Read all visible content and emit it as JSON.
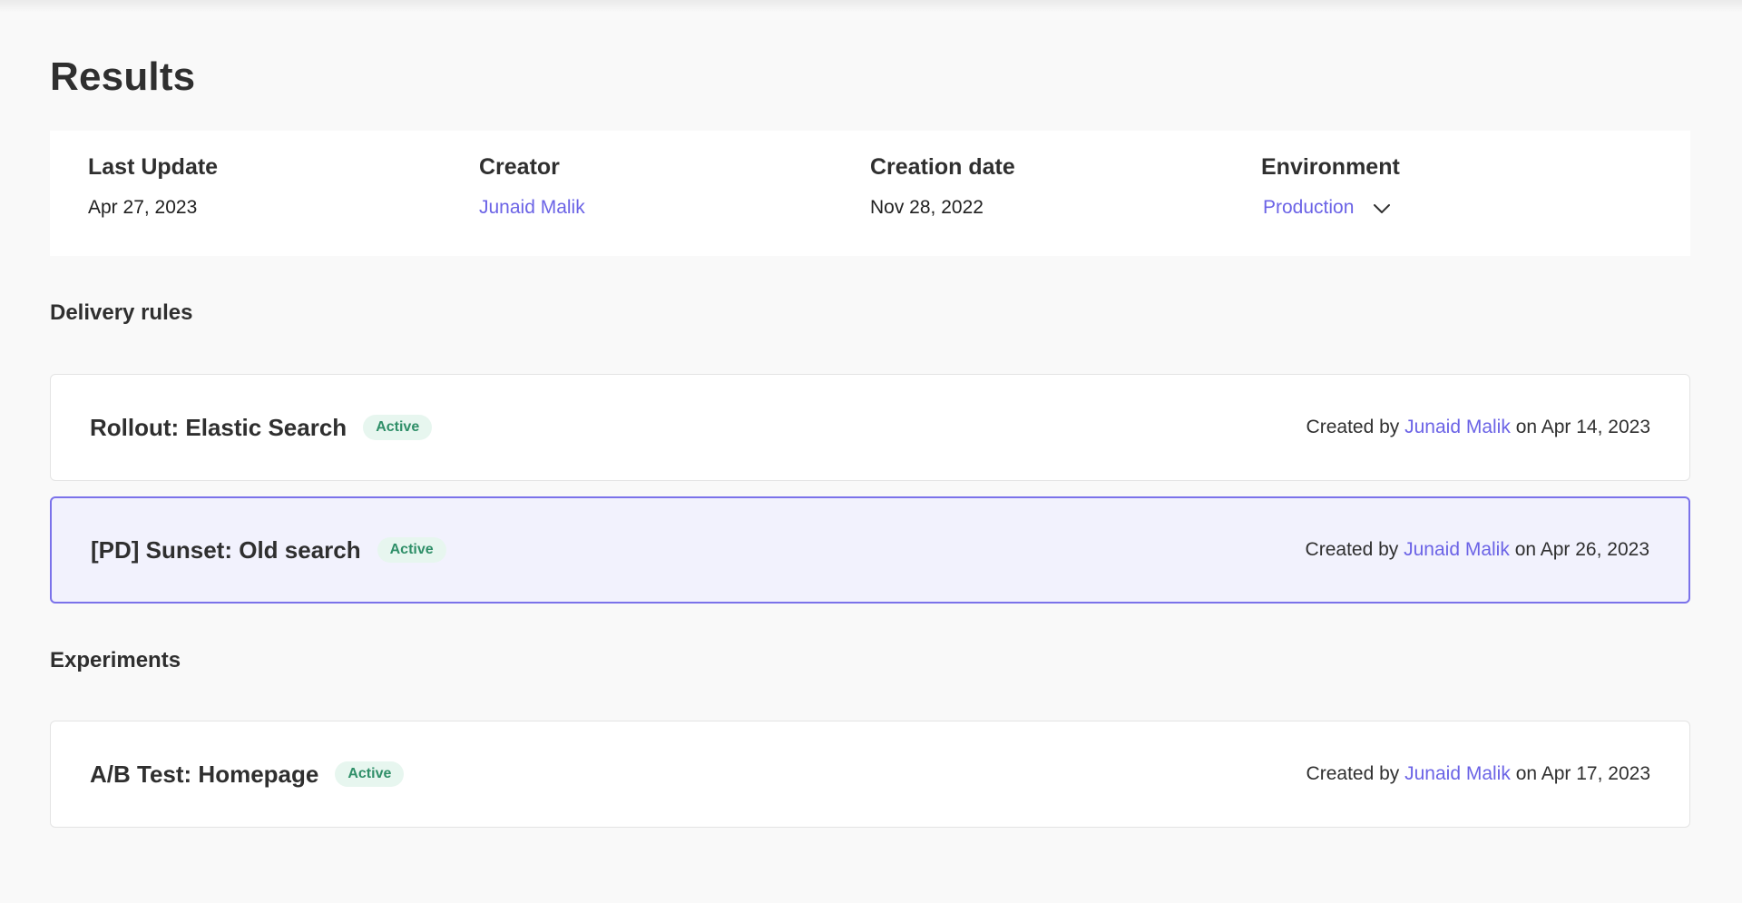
{
  "page": {
    "title": "Results"
  },
  "meta": {
    "last_update": {
      "label": "Last Update",
      "value": "Apr 27, 2023"
    },
    "creator": {
      "label": "Creator",
      "value": "Junaid Malik"
    },
    "creation_date": {
      "label": "Creation date",
      "value": "Nov 28, 2022"
    },
    "environment": {
      "label": "Environment",
      "value": "Production",
      "icon": "chevron-down-icon"
    }
  },
  "sections": {
    "delivery_rules": {
      "label": "Delivery rules",
      "items": [
        {
          "title": "Rollout: Elastic Search",
          "status": "Active",
          "created_by_prefix": "Created by",
          "author": "Junaid Malik",
          "date_text": "on Apr 14, 2023",
          "selected": false
        },
        {
          "title": "[PD] Sunset: Old search",
          "status": "Active",
          "created_by_prefix": "Created by",
          "author": "Junaid Malik",
          "date_text": "on Apr 26, 2023",
          "selected": true
        }
      ]
    },
    "experiments": {
      "label": "Experiments",
      "items": [
        {
          "title": "A/B Test: Homepage",
          "status": "Active",
          "created_by_prefix": "Created by",
          "author": "Junaid Malik",
          "date_text": "on Apr 17, 2023",
          "selected": false
        }
      ]
    }
  },
  "colors": {
    "accent": "#6b63e6",
    "selected_border": "#7b72ea",
    "selected_bg": "#f2f2fd",
    "badge_bg": "#e7f6ef",
    "badge_text": "#2f8f68",
    "page_bg": "#f9f9f9"
  }
}
